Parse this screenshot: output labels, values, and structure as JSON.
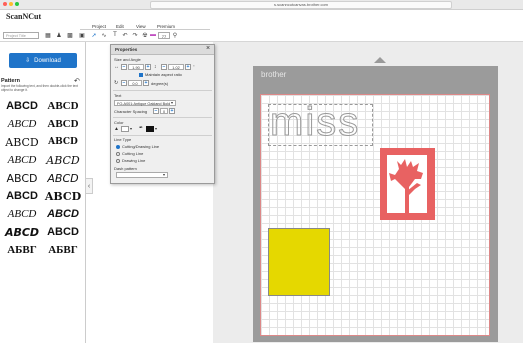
{
  "browser": {
    "url": "s.scanncutcanvas.brother.com"
  },
  "app": {
    "logo": "ScanNCut",
    "project_title_placeholder": "Project Title"
  },
  "menu": {
    "items": [
      "Project",
      "Edit",
      "View",
      "Premium"
    ]
  },
  "toolbar": {
    "zoom": "77"
  },
  "left": {
    "download_label": "Download",
    "pattern_title": "Pattern",
    "pattern_desc": "Import the following text, and then double-click the text object to change it.",
    "fonts": [
      "ABCD",
      "ABCD",
      "ABCD",
      "ABCD",
      "ABCD",
      "ABCD",
      "ABCD",
      "ABCD",
      "ABCD",
      "ABCD",
      "ABCD",
      "ABCD",
      "ABCD",
      "ABCD",
      "ABCD",
      "ABCD",
      "АБВГ",
      "АБВГ"
    ]
  },
  "props": {
    "title": "Properties",
    "size_label": "Size and Angle",
    "width": "1.90",
    "height": "1.02",
    "unit": "\"",
    "aspect_label": "Maintain aspect ratio",
    "angle": "0.0",
    "angle_unit": "degree(s)",
    "text_label": "Text",
    "font_value": "FO-A001:Antique Oakland Bold",
    "spacing_label": "Character Spacing",
    "spacing_value": "0",
    "color_label": "Color",
    "line_type_label": "Line Type",
    "line_options": [
      "Cutting/Drawing Line",
      "Cutting Line",
      "Drawing Line"
    ],
    "dash_label": "Dash pattern"
  },
  "canvas": {
    "brand": "brother",
    "text_object": "miss"
  },
  "colors": {
    "accent": "#1f74c9",
    "tree": "#e86262",
    "yellow": "#e5d800"
  }
}
